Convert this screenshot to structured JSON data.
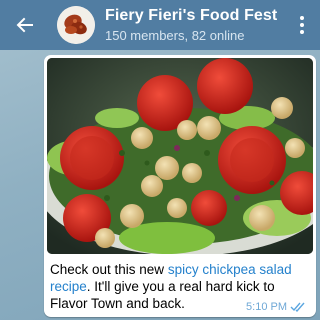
{
  "header": {
    "title": "Fiery Fieri's Food Fest",
    "subtitle": "150 members, 82 online",
    "bg_color": "#517da2",
    "icons": [
      "back-arrow-icon",
      "more-vert-icon"
    ]
  },
  "message": {
    "text_before": "Check out this new ",
    "link_text": "spicy chickpea salad recipe",
    "text_after": ". It'll give you a real hard kick to Flavor Town and back.",
    "time": "5:10 PM",
    "status_icon": "double-check-icon",
    "link_color": "#2481cc"
  }
}
